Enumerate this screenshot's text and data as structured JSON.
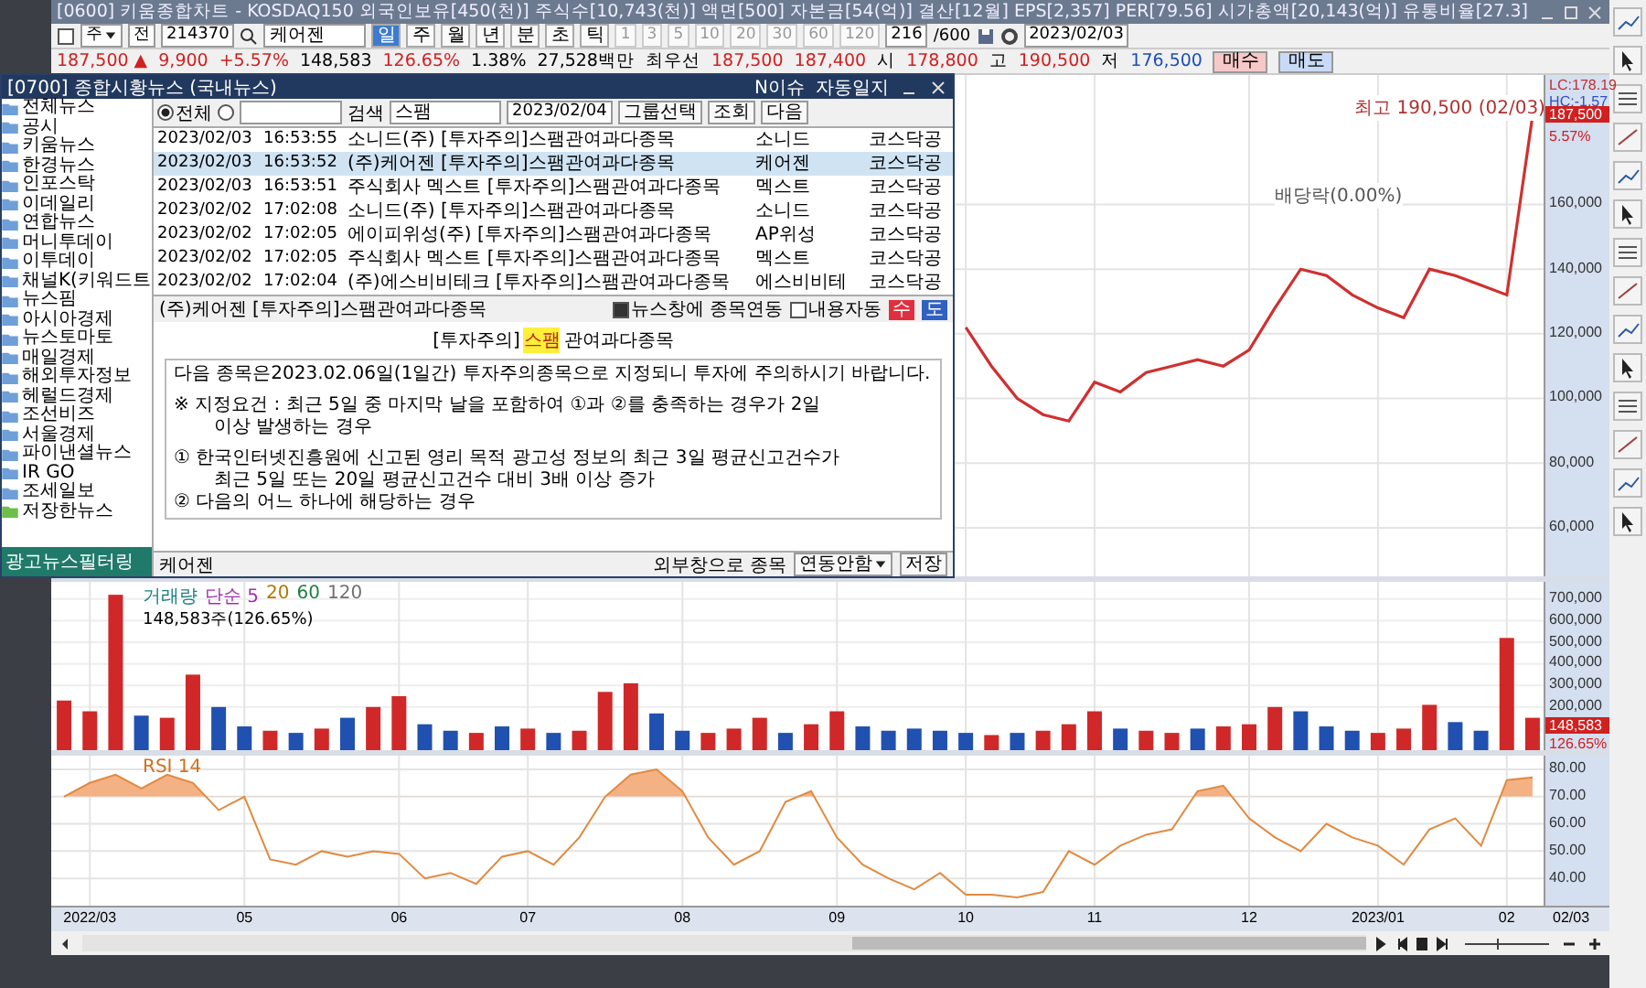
{
  "main_window": {
    "title": "[0600] 키움종합차트 - KOSDAQ150 외국인보유[450(천)] 주식수[10,743(천)] 액면[500] 자본금[54(억)] 결산[12월] EPS[2,357] PER[79.56] 시가총액[20,143(억)] 유통비율[27.3]",
    "toolbar": {
      "asset_type": "주",
      "scope": "전",
      "code": "214370",
      "name": "케어젠",
      "periods": [
        {
          "label": "일",
          "selected": true
        },
        {
          "label": "주",
          "selected": false
        },
        {
          "label": "월",
          "selected": false
        },
        {
          "label": "년",
          "selected": false
        },
        {
          "label": "분",
          "selected": false
        },
        {
          "label": "초",
          "selected": false
        },
        {
          "label": "틱",
          "selected": false
        }
      ],
      "intervals": [
        {
          "label": "1",
          "disabled": true
        },
        {
          "label": "3",
          "disabled": true
        },
        {
          "label": "5",
          "disabled": true
        },
        {
          "label": "10",
          "disabled": true
        },
        {
          "label": "20",
          "disabled": true
        },
        {
          "label": "30",
          "disabled": true
        },
        {
          "label": "60",
          "disabled": true
        },
        {
          "label": "120",
          "disabled": true
        }
      ],
      "count": "216",
      "max_count": "/600",
      "date": "2023/02/03"
    },
    "quote": {
      "price": "187,500 ▲",
      "change": "9,900",
      "change_pct": "+5.57%",
      "volume": "148,583",
      "volume_ratio": "126.65%",
      "turnover": "1.38%",
      "amount": "27,528백만",
      "best_label": "최우선",
      "ask": "187,500",
      "bid": "187,400",
      "open_label": "시",
      "open": "178,800",
      "high_label": "고",
      "high": "190,500",
      "low_label": "저",
      "low": "176,500"
    },
    "buy_button": "매수",
    "sell_button": "매도",
    "price_panel": {
      "lc": "LC:178.19",
      "hc": "HC:-1.57",
      "price_tag": "187,500",
      "change_tag": "5.57%",
      "chart_data": {
        "type": "line",
        "grid": true,
        "categories": [
          null,
          null,
          null,
          null,
          null,
          null,
          null,
          null,
          null,
          null,
          null,
          null,
          null,
          null,
          null,
          null,
          null,
          null,
          null,
          null,
          null,
          null,
          null,
          null,
          null,
          null,
          null,
          null,
          null,
          null,
          null,
          null,
          null,
          null,
          null,
          null,
          null,
          null,
          null,
          null,
          null,
          null,
          null,
          null,
          null,
          null,
          null,
          null,
          null,
          null,
          null,
          null,
          null,
          null,
          null,
          null,
          null,
          null
        ],
        "series": [
          {
            "color": "#d03030",
            "values": [
              null,
              null,
              null,
              null,
              null,
              null,
              null,
              null,
              null,
              null,
              null,
              null,
              null,
              null,
              null,
              null,
              null,
              null,
              null,
              null,
              null,
              null,
              null,
              null,
              null,
              null,
              null,
              null,
              null,
              null,
              null,
              null,
              null,
              null,
              null,
              122000,
              110000,
              100000,
              95000,
              93000,
              105000,
              102000,
              108000,
              110000,
              112000,
              110000,
              115000,
              128000,
              140000,
              138000,
              132000,
              128000,
              125000,
              140000,
              138000,
              135000,
              132000,
              187500
            ]
          }
        ],
        "ylim": [
          45000,
          200000
        ],
        "yticks": [
          {
            "value": 60000,
            "label": "60,000"
          },
          {
            "value": 80000,
            "label": "80,000"
          },
          {
            "value": 100000,
            "label": "100,000"
          },
          {
            "value": 120000,
            "label": "120,000"
          },
          {
            "value": 140000,
            "label": "140,000"
          },
          {
            "value": 160000,
            "label": "160,000"
          }
        ],
        "annotations": [
          "최고 190,500 (02/03)",
          "배당락(0.00%)"
        ]
      }
    },
    "volume_panel": {
      "legend": [
        {
          "label": "거래량",
          "color": "#1f7f7f"
        },
        {
          "label": "단순 5",
          "color": "#a030b0"
        },
        {
          "label": "20",
          "color": "#b07800"
        },
        {
          "label": "60",
          "color": "#208040"
        },
        {
          "label": "120",
          "color": "#707070"
        }
      ],
      "reading": "148,583주(126.65%)",
      "value_tag": "148,583",
      "ratio_tag": "126.65%",
      "chart_data": {
        "type": "bar",
        "grid": true,
        "stacked": true,
        "categories": [
          null,
          null,
          null,
          null,
          null,
          null,
          null,
          null,
          null,
          null,
          null,
          null,
          null,
          null,
          null,
          null,
          null,
          null,
          null,
          null,
          null,
          null,
          null,
          null,
          null,
          null,
          null,
          null,
          null,
          null,
          null,
          null,
          null,
          null,
          null,
          null,
          null,
          null,
          null,
          null,
          null,
          null,
          null,
          null,
          null,
          null,
          null,
          null,
          null,
          null,
          null,
          null,
          null,
          null,
          null,
          null,
          null,
          null
        ],
        "series": [
          {
            "color": "#d02828",
            "values": [
              230000,
              180000,
              720000,
              null,
              150000,
              350000,
              null,
              null,
              90000,
              null,
              100000,
              null,
              200000,
              250000,
              null,
              null,
              80000,
              null,
              100000,
              null,
              90000,
              270000,
              310000,
              null,
              null,
              80000,
              100000,
              150000,
              null,
              120000,
              180000,
              null,
              null,
              null,
              null,
              null,
              70000,
              null,
              90000,
              120000,
              180000,
              null,
              90000,
              80000,
              null,
              110000,
              120000,
              200000,
              null,
              null,
              null,
              80000,
              100000,
              210000,
              null,
              null,
              520000,
              150000
            ]
          },
          {
            "color": "#2050b0",
            "values": [
              null,
              null,
              null,
              160000,
              null,
              null,
              200000,
              110000,
              null,
              80000,
              null,
              150000,
              null,
              null,
              120000,
              90000,
              null,
              110000,
              null,
              80000,
              null,
              null,
              null,
              170000,
              90000,
              null,
              null,
              null,
              80000,
              null,
              null,
              110000,
              90000,
              100000,
              90000,
              80000,
              null,
              80000,
              null,
              null,
              null,
              100000,
              null,
              null,
              100000,
              null,
              null,
              null,
              180000,
              110000,
              90000,
              null,
              null,
              null,
              130000,
              90000,
              null,
              null
            ]
          }
        ],
        "ylim": [
          0,
          780000
        ],
        "yticks": [
          {
            "value": 200000,
            "label": "200,000"
          },
          {
            "value": 300000,
            "label": "300,000"
          },
          {
            "value": 400000,
            "label": "400,000"
          },
          {
            "value": 500000,
            "label": "500,000"
          },
          {
            "value": 600000,
            "label": "600,000"
          },
          {
            "value": 700000,
            "label": "700,000"
          }
        ]
      }
    },
    "rsi_panel": {
      "end_label": "02/03",
      "chart_data": {
        "type": "line",
        "grid": true,
        "categories": [
          null,
          "2022/03",
          null,
          null,
          null,
          null,
          null,
          "05",
          null,
          null,
          null,
          null,
          null,
          "06",
          null,
          null,
          null,
          null,
          "07",
          null,
          null,
          null,
          null,
          null,
          "08",
          null,
          null,
          null,
          null,
          null,
          "09",
          null,
          null,
          null,
          null,
          "10",
          null,
          null,
          null,
          null,
          "11",
          null,
          null,
          null,
          null,
          null,
          "12",
          null,
          null,
          null,
          null,
          "2023/01",
          null,
          null,
          null,
          null,
          "02",
          null
        ],
        "series": [
          {
            "name": "RSI 14",
            "color": "#e08a40",
            "values": [
              70,
              75,
              78,
              73,
              78,
              75,
              65,
              70,
              47,
              45,
              50,
              48,
              50,
              49,
              40,
              42,
              38,
              48,
              50,
              45,
              55,
              70,
              78,
              80,
              72,
              55,
              45,
              50,
              68,
              72,
              55,
              45,
              40,
              36,
              42,
              34,
              34,
              33,
              35,
              50,
              45,
              52,
              56,
              58,
              72,
              74,
              62,
              55,
              50,
              60,
              55,
              52,
              45,
              58,
              62,
              52,
              76,
              77
            ]
          }
        ],
        "ylim": [
          30,
          85
        ],
        "yticks": [
          {
            "value": 40,
            "label": "40.00"
          },
          {
            "value": 50,
            "label": "50.00"
          },
          {
            "value": 60,
            "label": "60.00"
          },
          {
            "value": 70,
            "label": "70.00"
          },
          {
            "value": 80,
            "label": "80.00"
          }
        ]
      }
    }
  },
  "news_window": {
    "title": "[0700] 종합시황뉴스 (국내뉴스)",
    "issue_button": "N이슈",
    "journal_button": "자동일지",
    "sources": [
      {
        "label": "전체뉴스",
        "kind": "folder"
      },
      {
        "label": "공시",
        "kind": "folder"
      },
      {
        "label": "키움뉴스",
        "kind": "folder"
      },
      {
        "label": "한경뉴스",
        "kind": "folder"
      },
      {
        "label": "인포스탁",
        "kind": "folder"
      },
      {
        "label": "이데일리",
        "kind": "folder"
      },
      {
        "label": "연합뉴스",
        "kind": "folder"
      },
      {
        "label": "머니투데이",
        "kind": "folder"
      },
      {
        "label": "이투데이",
        "kind": "folder"
      },
      {
        "label": "채널K(키워드트",
        "kind": "folder"
      },
      {
        "label": "뉴스핌",
        "kind": "folder"
      },
      {
        "label": "아시아경제",
        "kind": "folder"
      },
      {
        "label": "뉴스토마토",
        "kind": "folder"
      },
      {
        "label": "매일경제",
        "kind": "folder"
      },
      {
        "label": "해외투자정보",
        "kind": "folder"
      },
      {
        "label": "헤럴드경제",
        "kind": "folder"
      },
      {
        "label": "조선비즈",
        "kind": "folder"
      },
      {
        "label": "서울경제",
        "kind": "folder"
      },
      {
        "label": "파이낸셜뉴스",
        "kind": "folder"
      },
      {
        "label": "IR GO",
        "kind": "folder"
      },
      {
        "label": "조세일보",
        "kind": "folder"
      },
      {
        "label": "저장한뉴스",
        "kind": "saved"
      }
    ],
    "filter_button": "광고뉴스필터링",
    "scope_options": [
      {
        "label": "전체",
        "selected": true
      },
      {
        "selected": false
      }
    ],
    "search_label": "검색",
    "search_value": "스팸",
    "date": "2023/02/04",
    "group_select": "그룹선택",
    "query_button": "조회",
    "next_button": "다음",
    "rows": [
      {
        "date": "2023/02/03",
        "time": "16:53:55",
        "title": "소니드(주) [투자주의]스팸관여과다종목",
        "company": "소니드",
        "market": "코스닥공",
        "selected": false
      },
      {
        "date": "2023/02/03",
        "time": "16:53:52",
        "title": "(주)케어젠 [투자주의]스팸관여과다종목",
        "company": "케어젠",
        "market": "코스닥공",
        "selected": true
      },
      {
        "date": "2023/02/03",
        "time": "16:53:51",
        "title": "주식회사 멕스트 [투자주의]스팸관여과다종목",
        "company": "멕스트",
        "market": "코스닥공",
        "selected": false
      },
      {
        "date": "2023/02/02",
        "time": "17:02:08",
        "title": "소니드(주) [투자주의]스팸관여과다종목",
        "company": "소니드",
        "market": "코스닥공",
        "selected": false
      },
      {
        "date": "2023/02/02",
        "time": "17:02:05",
        "title": "에이피위성(주) [투자주의]스팸관여과다종목",
        "company": "AP위성",
        "market": "코스닥공",
        "selected": false
      },
      {
        "date": "2023/02/02",
        "time": "17:02:05",
        "title": "주식회사 멕스트 [투자주의]스팸관여과다종목",
        "company": "멕스트",
        "market": "코스닥공",
        "selected": false
      },
      {
        "date": "2023/02/02",
        "time": "17:02:04",
        "title": "(주)에스비비테크 [투자주의]스팸관여과다종목",
        "company": "에스비비테",
        "market": "코스닥공",
        "selected": false
      }
    ],
    "article": {
      "title": "(주)케어젠 [투자주의]스팸관여과다종목",
      "link_stock": {
        "label": "뉴스창에 종목연동",
        "checked": true
      },
      "auto_content": {
        "label": "내용자동",
        "checked": false
      },
      "buy_button": "수",
      "sell_button": "도",
      "heading_prefix": "[투자주의]",
      "heading_highlight": "스팸",
      "heading_suffix": "관여과다종목",
      "sections": [
        [
          {
            "text": "다음 종목은2023.02.06일(1일간) 투자주의종목으로 지정되니 투자에 주의하시기 바랍니다.",
            "indent": false
          }
        ],
        [
          {
            "text": "※ 지정요건 : 최근 5일 중 마지막 날을 포함하여 ①과 ②를 충족하는 경우가 2일",
            "indent": false
          },
          {
            "text": "이상 발생하는 경우",
            "indent": true
          }
        ],
        [
          {
            "text": "① 한국인터넷진흥원에 신고된 영리 목적 광고성 정보의 최근 3일 평균신고건수가",
            "indent": false
          },
          {
            "text": "최근 5일 또는 20일 평균신고건수 대비 3배 이상 증가",
            "indent": true
          },
          {
            "text": "② 다음의 어느 하나에 해당하는 경우",
            "indent": false
          }
        ]
      ]
    },
    "footer_stock": "케어젠",
    "external_label": "외부창으로 종목",
    "link_mode": "연동안함",
    "save_button": "저장"
  }
}
